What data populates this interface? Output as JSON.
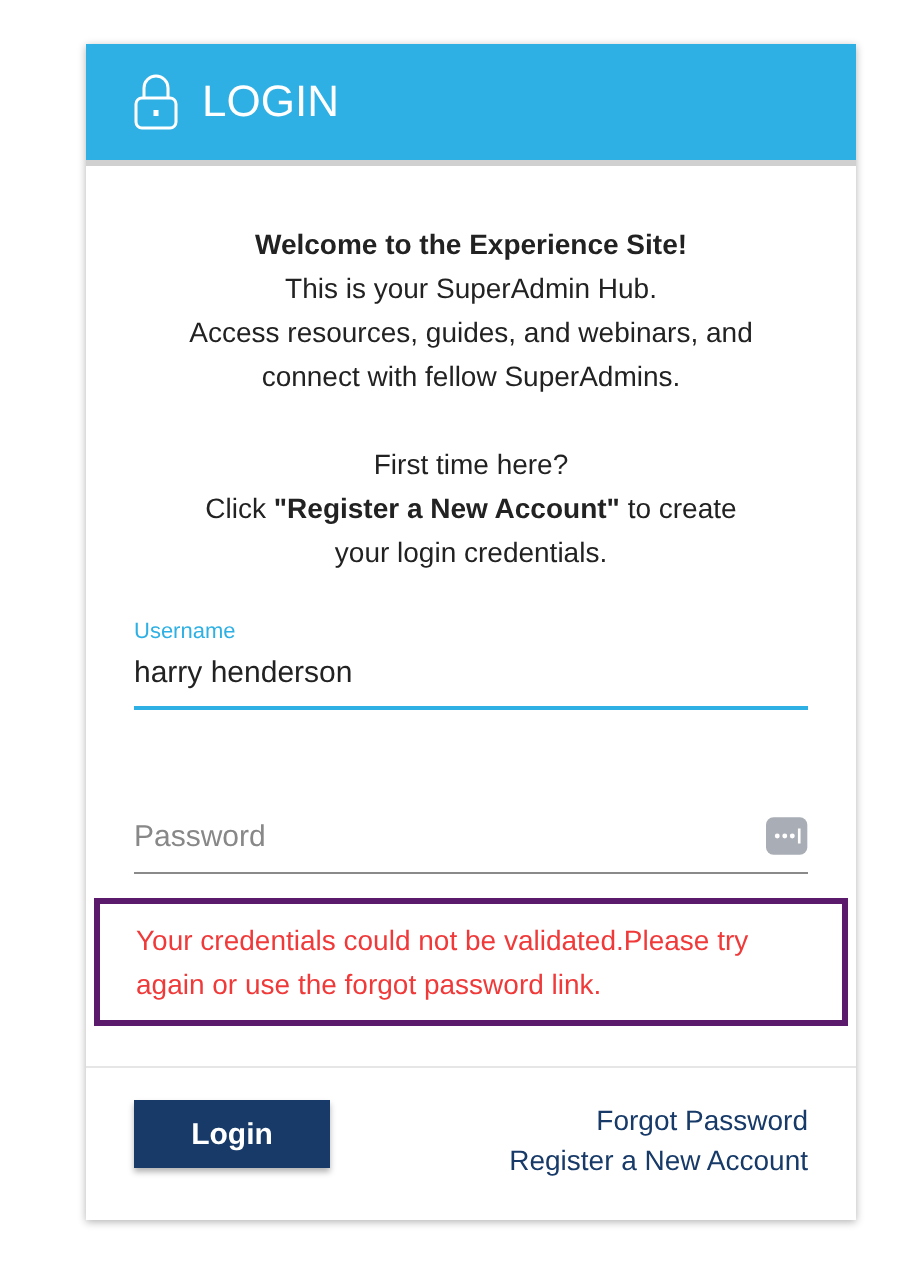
{
  "header": {
    "title": "LOGIN"
  },
  "intro": {
    "heading": "Welcome to the Experience Site!",
    "lines": [
      "This is your SuperAdmin Hub.",
      "Access resources, guides, and webinars, and connect with fellow SuperAdmins."
    ],
    "prompt": [
      "First time here?",
      "Click **\"Register a New Account\"** to create your login credentials."
    ]
  },
  "username": {
    "label": "Username",
    "value": "harry henderson",
    "focused": true
  },
  "password": {
    "placeholder": "Password",
    "focused": false
  },
  "error": "Your credentials could not be validated.Please try again or use the forgot password link.",
  "login_button": "Login",
  "links": [
    "Forgot Password",
    "Register a New Account"
  ]
}
